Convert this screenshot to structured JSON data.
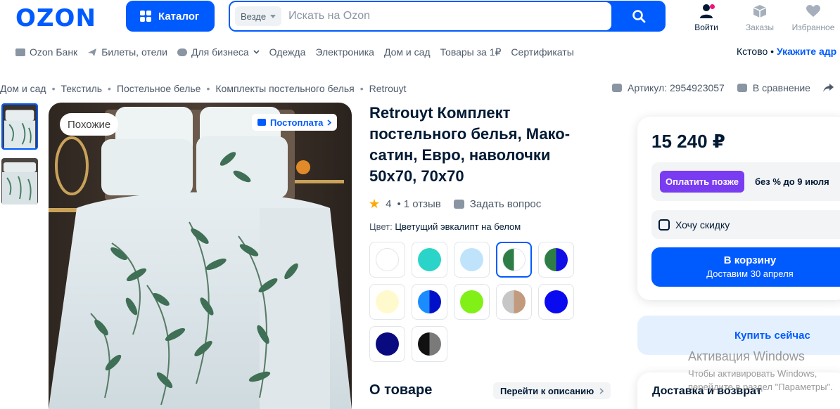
{
  "header": {
    "logo": "OZON",
    "catalog_label": "Каталог",
    "search_scope": "Везде",
    "search_placeholder": "Искать на Ozon",
    "login_label": "Войти",
    "orders_label": "Заказы",
    "favorites_label": "Избранное"
  },
  "nav": {
    "items": [
      "Ozon Банк",
      "Билеты, отели",
      "Для бизнеса",
      "Одежда",
      "Электроника",
      "Дом и сад",
      "Товары за 1₽",
      "Сертификаты"
    ],
    "location_prefix": "Кстово",
    "location_link": "Укажите адр"
  },
  "breadcrumbs": [
    "Дом и сад",
    "Текстиль",
    "Постельное белье",
    "Комплекты постельного белья",
    "Retrouyt"
  ],
  "meta": {
    "article": "Артикул: 2954923057",
    "compare": "В сравнение"
  },
  "gallery": {
    "similar_label": "Похожие",
    "postpay_label": "Постоплата"
  },
  "product": {
    "title": "Retrouyt Комплект постельного белья, Мако-сатин, Евро, наволочки 50х70, 70х70",
    "rating": "4",
    "reviews": "1 отзыв",
    "ask_question": "Задать вопрос",
    "color_label": "Цвет:",
    "color_value": "Цветущий эвкалипт на белом",
    "swatches": [
      {
        "name": "white",
        "colors": [
          "#ffffff",
          "#ffffff"
        ],
        "selected": false
      },
      {
        "name": "turquoise",
        "colors": [
          "#2bd4c8",
          "#2bd4c8"
        ],
        "selected": false
      },
      {
        "name": "light-blue",
        "colors": [
          "#bfe3fb",
          "#bfe3fb"
        ],
        "selected": false
      },
      {
        "name": "green-white",
        "colors": [
          "#2e7d46",
          "#ffffff"
        ],
        "selected": true
      },
      {
        "name": "green-blue",
        "colors": [
          "#2e7d46",
          "#1010e6"
        ],
        "selected": false
      },
      {
        "name": "cream",
        "colors": [
          "#fffacd",
          "#fffacd"
        ],
        "selected": false
      },
      {
        "name": "blue-navy",
        "colors": [
          "#1a8cff",
          "#0010c8"
        ],
        "selected": false
      },
      {
        "name": "lime",
        "colors": [
          "#80f016",
          "#80f016"
        ],
        "selected": false
      },
      {
        "name": "grey-beige",
        "colors": [
          "#c6c6c6",
          "#c29a7e"
        ],
        "selected": false
      },
      {
        "name": "blue",
        "colors": [
          "#0a0af0",
          "#0a0af0"
        ],
        "selected": false
      },
      {
        "name": "navy",
        "colors": [
          "#0a0a80",
          "#0a0a80"
        ],
        "selected": false
      },
      {
        "name": "black-grey",
        "colors": [
          "#111111",
          "#7a7a7a"
        ],
        "selected": false
      }
    ],
    "about_title": "О товаре",
    "goto_description": "Перейти к описанию"
  },
  "buy_panel": {
    "price": "15 240 ₽",
    "pay_later_label": "Оплатить позже",
    "pay_later_text": "без % до 9 июля",
    "want_discount": "Хочу скидку",
    "cart_label": "В корзину",
    "cart_sub": "Доставим 30 апреля",
    "buy_now": "Купить сейчас",
    "delivery_title": "Доставка и возврат"
  },
  "watermark": {
    "line1": "Активация Windows",
    "line2": "Чтобы активировать Windows, перейдите в раздел \"Параметры\"."
  },
  "colors": {
    "brand": "#005bff",
    "pay_later": "#7a3cf0",
    "star": "#ffa800"
  }
}
